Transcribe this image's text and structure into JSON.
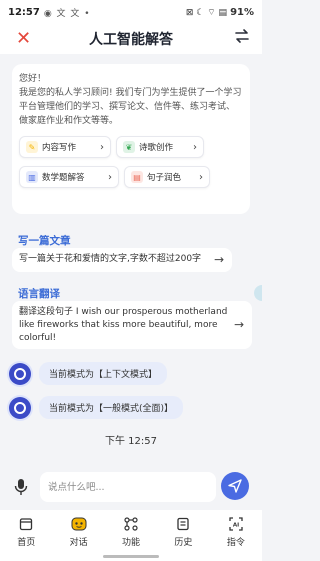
{
  "status_bar": {
    "time": "12:57",
    "icons": "◉ 文 文 •",
    "right_icons": "⊠ ☾ ⌔ ▤",
    "battery": "91%"
  },
  "header": {
    "title": "人工智能解答"
  },
  "welcome": {
    "hello": "您好！",
    "intro": "我是您的私人学习顾问! 我们专门为学生提供了一个学习平台管理他们的学习、撰写论文、信件等、练习考试、做家庭作业和作文等等。",
    "chips": [
      {
        "label": "内容写作",
        "icon": "✎",
        "color": "#f4b400"
      },
      {
        "label": "诗歌创作",
        "icon": "❦",
        "color": "#34a853"
      },
      {
        "label": "数学题解答",
        "icon": "▥",
        "color": "#4a6be2"
      },
      {
        "label": "句子润色",
        "icon": "▤",
        "color": "#ea6b5a"
      }
    ]
  },
  "suggestions": [
    {
      "title": "写一篇文章",
      "text": "写一篇关于花和爱情的文字,字数不超过200字"
    },
    {
      "title": "语言翻译",
      "text": "翻译这段句子  I wish our prosperous motherland like fireworks that kiss more beautiful, more colorful!"
    }
  ],
  "messages": [
    {
      "text": "当前模式为【上下文模式】"
    },
    {
      "text": "当前模式为【一般模式(全面)】"
    }
  ],
  "timestamp": "下午 12:57",
  "input": {
    "placeholder": "说点什么吧..."
  },
  "nav": [
    {
      "label": "首页"
    },
    {
      "label": "对话"
    },
    {
      "label": "功能"
    },
    {
      "label": "历史"
    },
    {
      "label": "指令"
    }
  ],
  "colors": {
    "accent": "#4a6be2",
    "close": "#e4473b",
    "section": "#3b6bd6"
  }
}
